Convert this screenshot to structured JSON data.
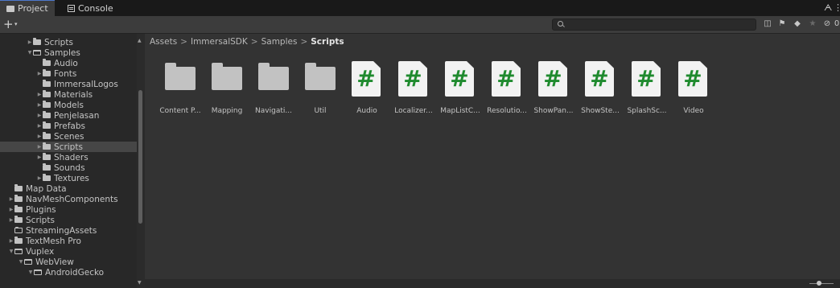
{
  "tabs": [
    {
      "label": "Project",
      "icon": "folder-icon",
      "active": true
    },
    {
      "label": "Console",
      "icon": "console-icon",
      "active": false
    }
  ],
  "toolbar": {
    "add_label": "+",
    "add_caret": "▾",
    "search": {
      "value": "",
      "placeholder": ""
    }
  },
  "tree": [
    {
      "label": "Scripts",
      "arrow": "right",
      "icon": "folder"
    },
    {
      "label": "Samples",
      "arrow": "down",
      "icon": "folder-open"
    },
    {
      "label": "Audio",
      "arrow": "",
      "icon": "folder"
    },
    {
      "label": "Fonts",
      "arrow": "right",
      "icon": "folder"
    },
    {
      "label": "ImmersalLogos",
      "arrow": "",
      "icon": "folder"
    },
    {
      "label": "Materials",
      "arrow": "right",
      "icon": "folder"
    },
    {
      "label": "Models",
      "arrow": "right",
      "icon": "folder"
    },
    {
      "label": "Penjelasan",
      "arrow": "right",
      "icon": "folder"
    },
    {
      "label": "Prefabs",
      "arrow": "right",
      "icon": "folder"
    },
    {
      "label": "Scenes",
      "arrow": "right",
      "icon": "folder"
    },
    {
      "label": "Scripts",
      "arrow": "right",
      "icon": "folder",
      "selected": true
    },
    {
      "label": "Shaders",
      "arrow": "right",
      "icon": "folder"
    },
    {
      "label": "Sounds",
      "arrow": "",
      "icon": "folder"
    },
    {
      "label": "Textures",
      "arrow": "right",
      "icon": "folder"
    },
    {
      "label": "Map Data",
      "arrow": "",
      "icon": "folder"
    },
    {
      "label": "NavMeshComponents",
      "arrow": "right",
      "icon": "folder"
    },
    {
      "label": "Plugins",
      "arrow": "right",
      "icon": "folder"
    },
    {
      "label": "Scripts",
      "arrow": "right",
      "icon": "folder"
    },
    {
      "label": "StreamingAssets",
      "arrow": "",
      "icon": "folder-outline"
    },
    {
      "label": "TextMesh Pro",
      "arrow": "right",
      "icon": "folder"
    },
    {
      "label": "Vuplex",
      "arrow": "down",
      "icon": "folder-open"
    },
    {
      "label": "WebView",
      "arrow": "down",
      "icon": "folder-open"
    },
    {
      "label": "AndroidGecko",
      "arrow": "down",
      "icon": "folder-open"
    }
  ],
  "breadcrumb": {
    "items": [
      "Assets",
      "ImmersalSDK",
      "Samples"
    ],
    "current": "Scripts",
    "separator": ">"
  },
  "assets": [
    {
      "label": "Content P...",
      "type": "folder"
    },
    {
      "label": "Mapping",
      "type": "folder"
    },
    {
      "label": "Navigati...",
      "type": "folder"
    },
    {
      "label": "Util",
      "type": "folder"
    },
    {
      "label": "Audio",
      "type": "script"
    },
    {
      "label": "Localizer...",
      "type": "script"
    },
    {
      "label": "MapListC...",
      "type": "script"
    },
    {
      "label": "Resolutio...",
      "type": "script"
    },
    {
      "label": "ShowPan...",
      "type": "script"
    },
    {
      "label": "ShowSte...",
      "type": "script"
    },
    {
      "label": "SplashSc...",
      "type": "script"
    },
    {
      "label": "Video",
      "type": "script"
    }
  ],
  "script_glyph": "#",
  "colors": {
    "script_hash": "#1f8a2e",
    "selected_row": "#464646",
    "panel_bg": "#333333"
  }
}
